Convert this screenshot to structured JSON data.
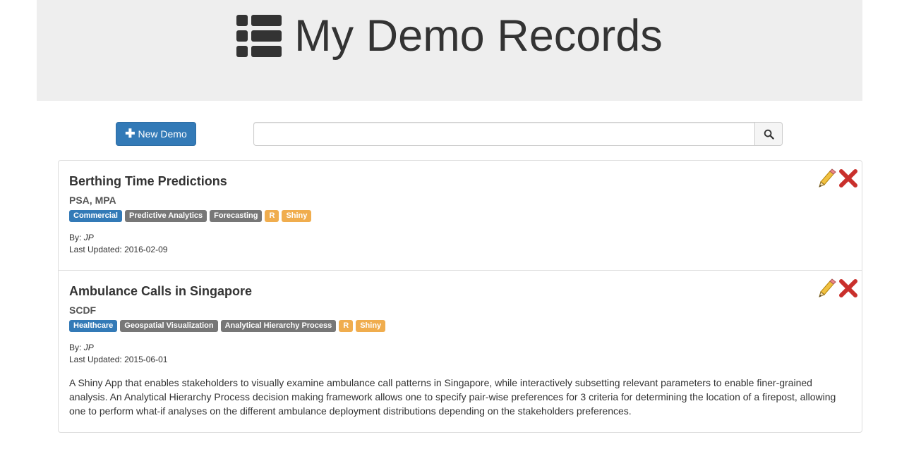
{
  "header": {
    "title": "My Demo Records",
    "icon": "list-icon"
  },
  "toolbar": {
    "new_button_label": "New Demo",
    "search_placeholder": "",
    "search_value": ""
  },
  "records": [
    {
      "title": "Berthing Time Predictions",
      "org": "PSA, MPA",
      "tags": [
        {
          "label": "Commercial",
          "style": "primary"
        },
        {
          "label": "Predictive Analytics",
          "style": "default"
        },
        {
          "label": "Forecasting",
          "style": "default"
        },
        {
          "label": "R",
          "style": "warning"
        },
        {
          "label": "Shiny",
          "style": "warning"
        }
      ],
      "by_label": "By:",
      "author": "JP",
      "updated_label": "Last Updated:",
      "updated": "2016-02-09",
      "description": ""
    },
    {
      "title": "Ambulance Calls in Singapore",
      "org": "SCDF",
      "tags": [
        {
          "label": "Healthcare",
          "style": "primary"
        },
        {
          "label": "Geospatial Visualization",
          "style": "default"
        },
        {
          "label": "Analytical Hierarchy Process",
          "style": "default"
        },
        {
          "label": "R",
          "style": "warning"
        },
        {
          "label": "Shiny",
          "style": "warning"
        }
      ],
      "by_label": "By:",
      "author": "JP",
      "updated_label": "Last Updated:",
      "updated": "2015-06-01",
      "description": "A Shiny App that enables stakeholders to visually examine ambulance call patterns in Singapore, while interactively subsetting relevant parameters to enable finer-grained analysis. An Analytical Hierarchy Process decision making framework allows one to specify pair-wise preferences for 3 criteria for determining the location of a firepost, allowing one to perform what-if analyses on the different ambulance deployment distributions depending on the stakeholders preferences."
    }
  ],
  "colors": {
    "primary": "#337ab7",
    "default": "#777777",
    "warning": "#f0ad4e",
    "delete": "#c9302c",
    "jumbotron": "#eeeeee"
  }
}
